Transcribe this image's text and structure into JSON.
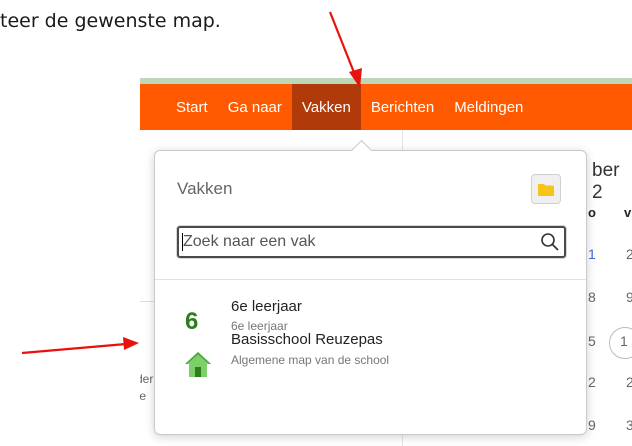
{
  "instruction": {
    "text": "teer de gewenste map."
  },
  "navbar": {
    "items": [
      {
        "label": "Start"
      },
      {
        "label": "Ga naar"
      },
      {
        "label": "Vakken",
        "active": true
      },
      {
        "label": "Berichten"
      },
      {
        "label": "Meldingen"
      }
    ]
  },
  "background": {
    "calendar_month_fragment": "ber 2",
    "day_headers": [
      "o",
      "v"
    ],
    "rows": [
      [
        "1",
        "2"
      ],
      [
        "8",
        "9"
      ],
      [
        "5",
        "1"
      ],
      [
        "2",
        "2"
      ],
      [
        "9",
        "3"
      ]
    ],
    "left_fragments": [
      "der",
      "te"
    ]
  },
  "popup": {
    "title": "Vakken",
    "folder_icon": "folder-icon",
    "search": {
      "placeholder": "Zoek naar een vak",
      "value": ""
    },
    "items": [
      {
        "icon_text": "6",
        "title": "6e leerjaar",
        "subtitle": "6e leerjaar"
      },
      {
        "icon": "house-icon",
        "title": "Basisschool Reuzepas",
        "subtitle": "Algemene map van de school"
      }
    ]
  },
  "colors": {
    "nav_orange": "#ff5a00",
    "nav_active": "#b13a0b",
    "accent_green": "#2e7d1f",
    "annotation_red": "#e8120c"
  }
}
